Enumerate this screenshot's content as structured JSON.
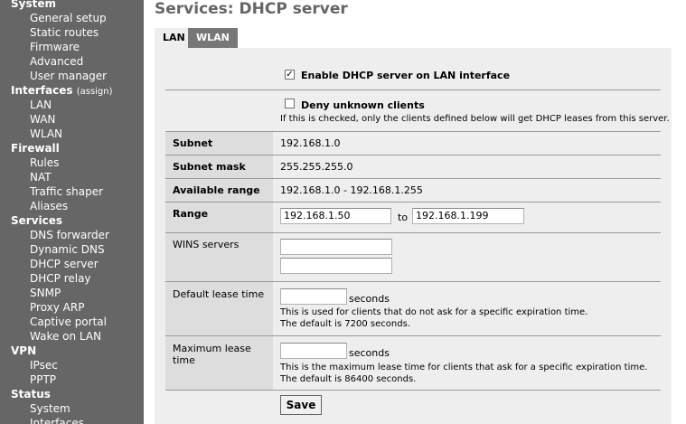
{
  "sidebar": {
    "groups": [
      {
        "label": "System",
        "items": [
          "General setup",
          "Static routes",
          "Firmware",
          "Advanced",
          "User manager"
        ]
      },
      {
        "label": "Interfaces",
        "sublabel": "(assign)",
        "items": [
          "LAN",
          "WAN",
          "WLAN"
        ]
      },
      {
        "label": "Firewall",
        "items": [
          "Rules",
          "NAT",
          "Traffic shaper",
          "Aliases"
        ]
      },
      {
        "label": "Services",
        "items": [
          "DNS forwarder",
          "Dynamic DNS",
          "DHCP server",
          "DHCP relay",
          "SNMP",
          "Proxy ARP",
          "Captive portal",
          "Wake on LAN"
        ]
      },
      {
        "label": "VPN",
        "items": [
          "IPsec",
          "PPTP"
        ]
      },
      {
        "label": "Status",
        "items": [
          "System",
          "Interfaces"
        ]
      }
    ]
  },
  "page_title": "Services: DHCP server",
  "tabs": [
    "LAN",
    "WLAN"
  ],
  "form": {
    "enable": {
      "label": "Enable DHCP server on LAN interface",
      "checked": true
    },
    "deny": {
      "label": "Deny unknown clients",
      "checked": false,
      "help": "If this is checked, only the clients defined below will get DHCP leases from this server."
    },
    "subnet": {
      "label": "Subnet",
      "value": "192.168.1.0"
    },
    "subnet_mask": {
      "label": "Subnet mask",
      "value": "255.255.255.0"
    },
    "available_range": {
      "label": "Available range",
      "value": "192.168.1.0 - 192.168.1.255"
    },
    "range": {
      "label": "Range",
      "from": "192.168.1.50",
      "to_label": "to",
      "to": "192.168.1.199"
    },
    "wins": {
      "label": "WINS servers",
      "server1": "",
      "server2": ""
    },
    "default_lease": {
      "label": "Default lease time",
      "value": "",
      "unit": "seconds",
      "help1": "This is used for clients that do not ask for a specific expiration time.",
      "help2": "The default is 7200 seconds."
    },
    "max_lease": {
      "label_line1": "Maximum lease",
      "label_line2": "time",
      "value": "",
      "unit": "seconds",
      "help1": "This is the maximum lease time for clients that ask for a specific expiration time.",
      "help2": "The default is 86400 seconds."
    },
    "save_label": "Save"
  }
}
